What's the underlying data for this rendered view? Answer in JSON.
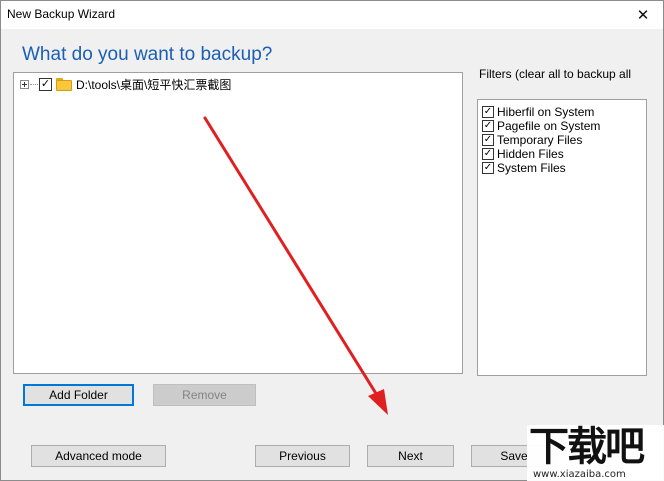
{
  "window": {
    "title": "New Backup Wizard",
    "close_glyph": "✕"
  },
  "heading": "What do you want to backup?",
  "tree": {
    "items": [
      {
        "label": "D:\\tools\\桌面\\短平快汇票截图",
        "checked": true,
        "icon": "folder-icon"
      }
    ]
  },
  "filters": {
    "title": "Filters (clear all to backup all",
    "items": [
      {
        "label": "Hiberfil on System",
        "checked": true
      },
      {
        "label": "Pagefile on System",
        "checked": true
      },
      {
        "label": "Temporary Files",
        "checked": true
      },
      {
        "label": "Hidden Files",
        "checked": true
      },
      {
        "label": "System Files",
        "checked": true
      }
    ]
  },
  "buttons": {
    "add_folder": "Add Folder",
    "remove": "Remove",
    "advanced_mode": "Advanced mode",
    "previous": "Previous",
    "next": "Next",
    "save": "Save"
  },
  "watermark": {
    "logo": "下载吧",
    "url": "www.xiazaiba.com"
  },
  "colors": {
    "heading": "#1a5fb4",
    "arrow": "#e02020",
    "focus": "#0078d7"
  }
}
